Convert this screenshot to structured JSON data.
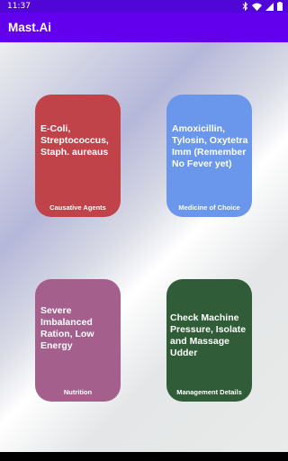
{
  "status_bar": {
    "time": "11:37",
    "icons": [
      "bluetooth-icon",
      "wifi-icon",
      "signal-icon",
      "battery-icon"
    ]
  },
  "app_bar": {
    "title": "Mast.Ai"
  },
  "cards": [
    {
      "text": "E-Coli, Streptococcus, Staph. aureaus",
      "caption": "Causative Agents",
      "color": "#c1434a"
    },
    {
      "text": "Amoxicillin, Tylosin, Oxytetra Imm (Remember No Fever yet)",
      "caption": "Medicine of Choice",
      "color": "#6a97ec"
    },
    {
      "text": "Severe Imbalanced Ration, Low Energy",
      "caption": "Nutrition",
      "color": "#a45f8c"
    },
    {
      "text": "Check Machine Pressure, Isolate and Massage Udder",
      "caption": "Management Details",
      "color": "#305d37"
    }
  ],
  "colors": {
    "status_bar": "#5106d8",
    "app_bar": "#6200ee"
  }
}
